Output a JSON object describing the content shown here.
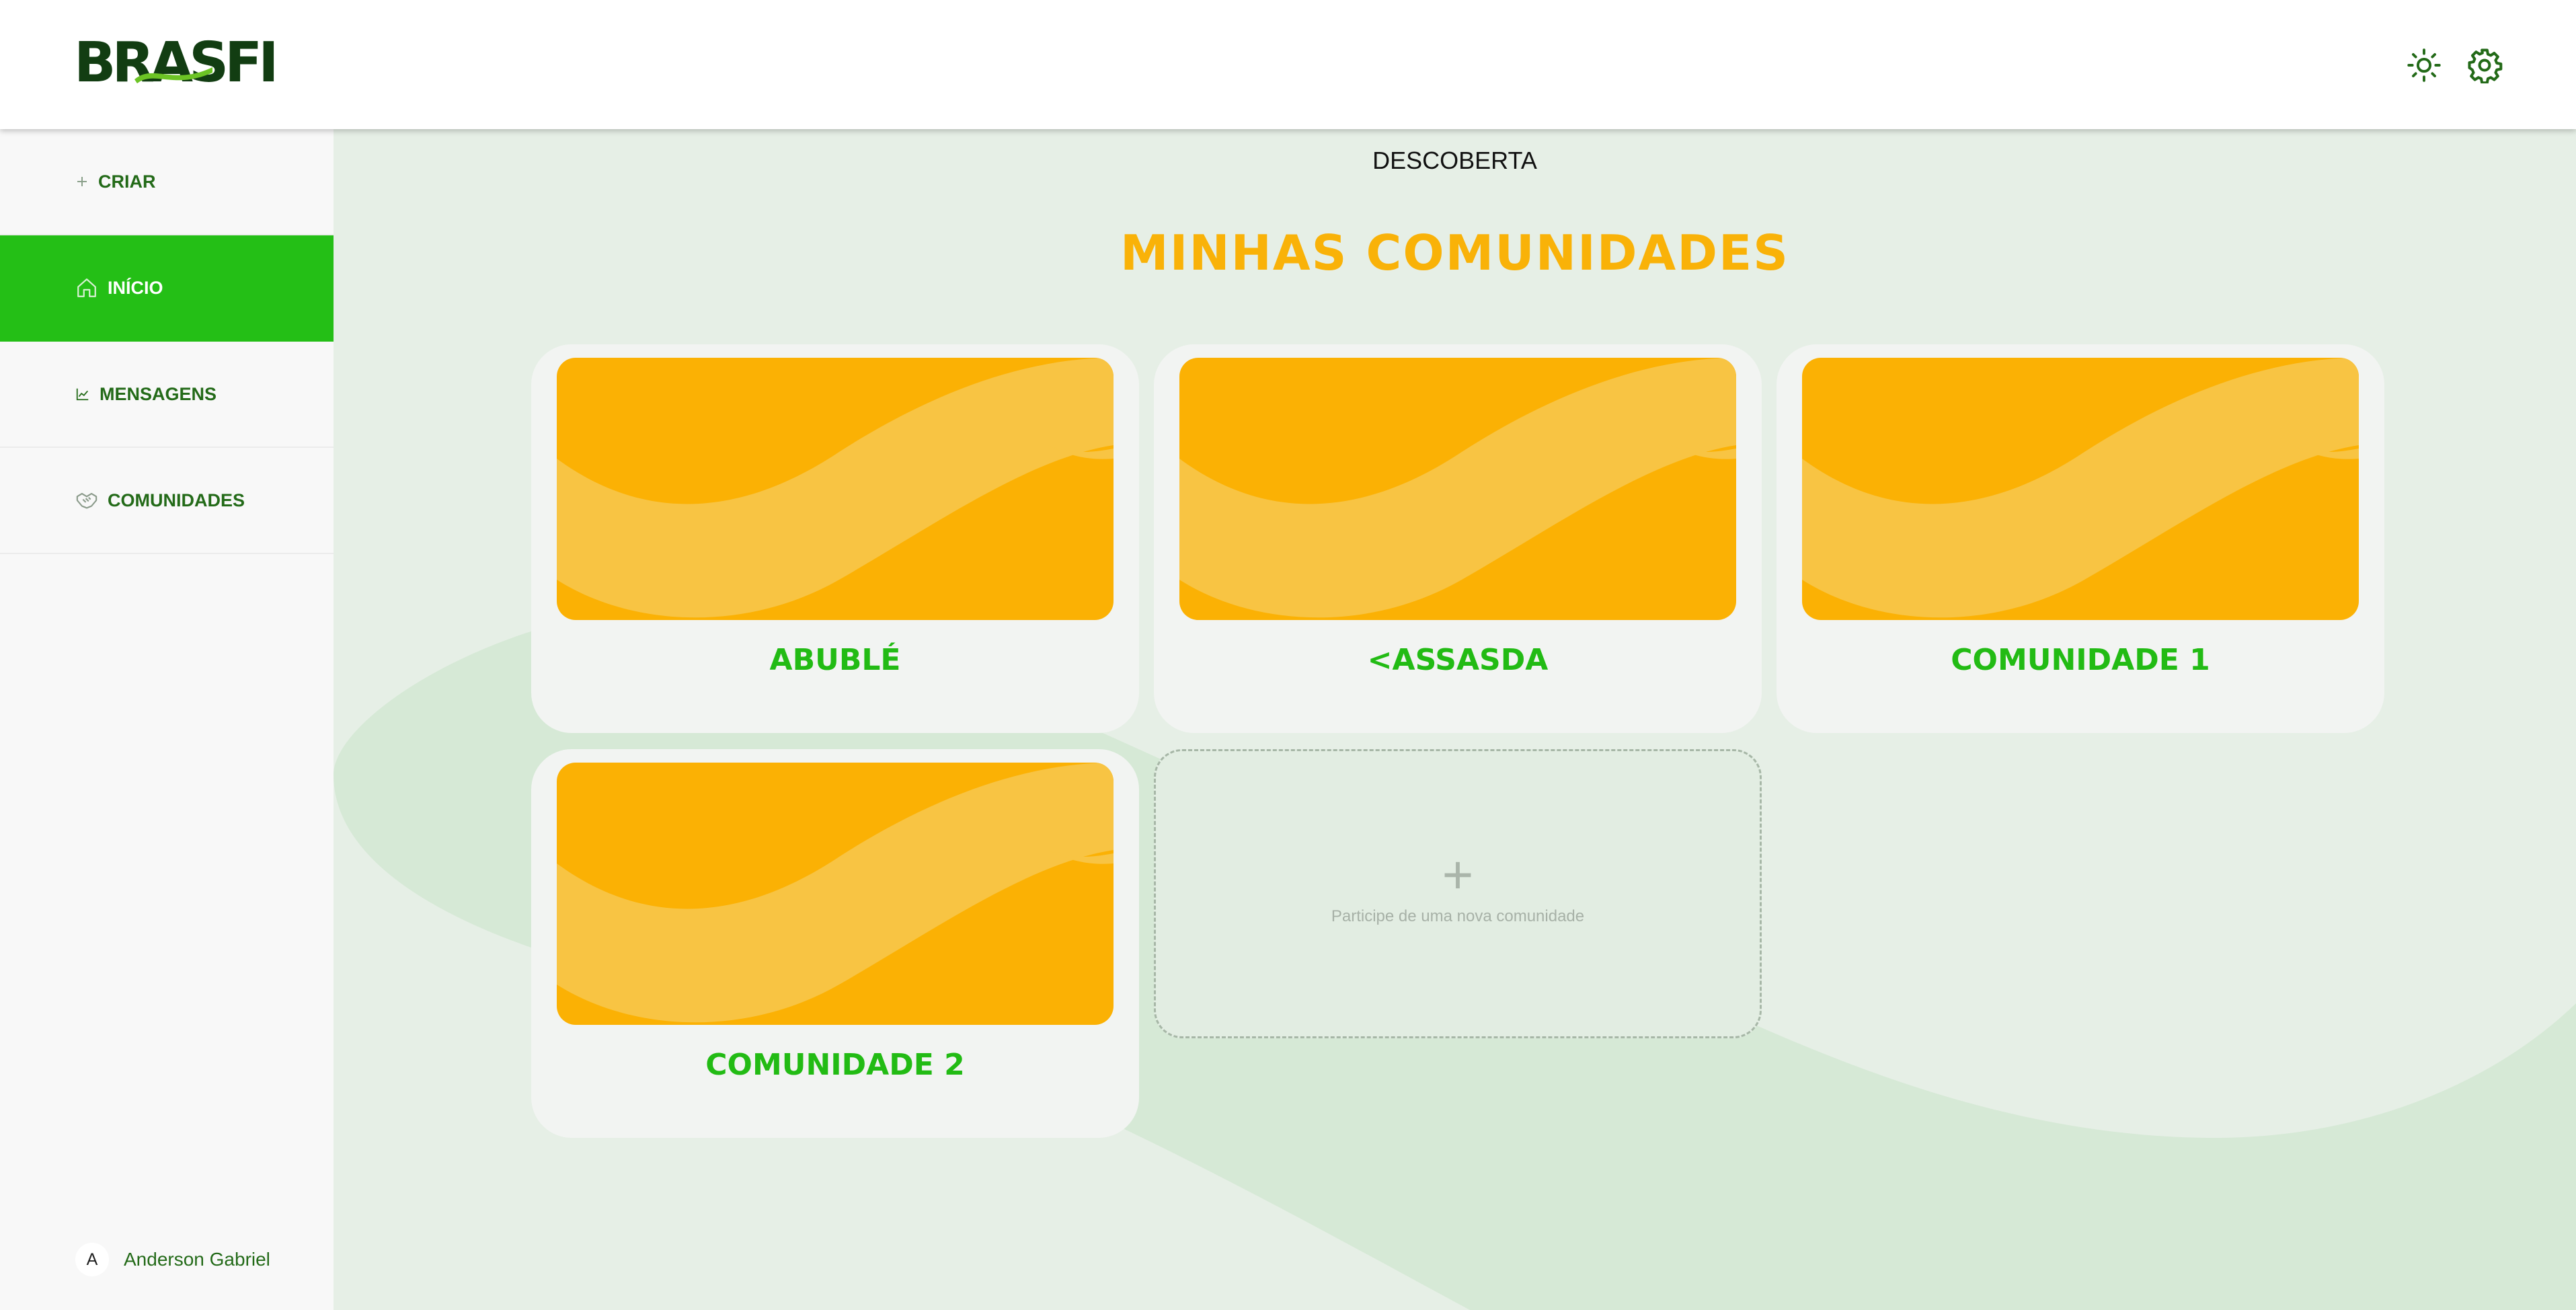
{
  "header": {
    "logo_text": "BRASFI",
    "icons": [
      "sun-icon",
      "gear-icon"
    ]
  },
  "sidebar": {
    "items": [
      {
        "label": "CRIAR",
        "icon": "plus-icon",
        "active": false
      },
      {
        "label": "INÍCIO",
        "icon": "home-icon",
        "active": true
      },
      {
        "label": "MENSAGENS",
        "icon": "chart-icon",
        "active": false
      },
      {
        "label": "COMUNIDADES",
        "icon": "handshake-icon",
        "active": false
      }
    ],
    "user": {
      "initial": "A",
      "name": "Anderson Gabriel"
    }
  },
  "main": {
    "discover_label": "DESCOBERTA",
    "title": "MINHAS COMUNIDADES",
    "communities": [
      {
        "name": "ABUBLÉ"
      },
      {
        "name": "<ASSASDA"
      },
      {
        "name": "COMUNIDADE 1"
      },
      {
        "name": "COMUNIDADE 2"
      }
    ],
    "join_card": {
      "icon": "plus-icon",
      "label": "Participe de uma nova comunidade"
    }
  },
  "colors": {
    "accent_green": "#24bf16",
    "dark_green": "#236a18",
    "title_yellow": "#f9b208",
    "card_image_orange": "#fbb104",
    "card_image_wave": "#f8c443",
    "background": "#e6efe6"
  }
}
